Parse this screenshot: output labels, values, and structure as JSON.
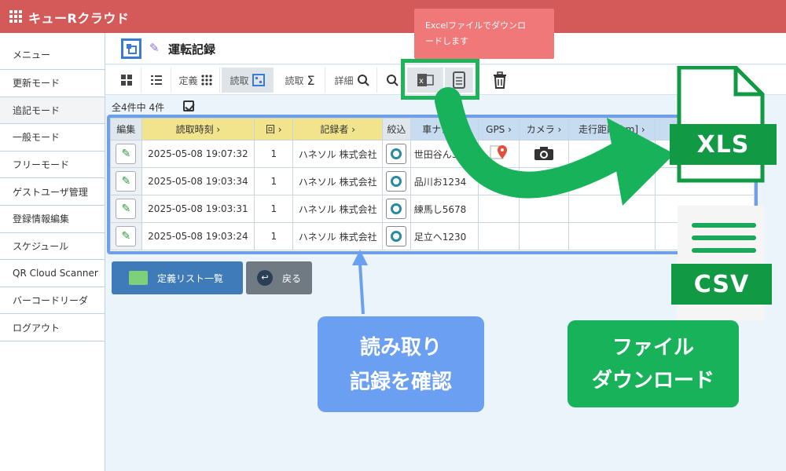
{
  "app": {
    "title": "キューRクラウド"
  },
  "sidebar": {
    "items": [
      {
        "label": "メニュー"
      },
      {
        "label": "更新モード"
      },
      {
        "label": "追記モード"
      },
      {
        "label": "一般モード"
      },
      {
        "label": "フリーモード"
      },
      {
        "label": "ゲストユーザ管理"
      },
      {
        "label": "登録情報編集"
      },
      {
        "label": "スケジュール"
      },
      {
        "label": "QR Cloud Scanner"
      },
      {
        "label": "バーコードリーダ"
      },
      {
        "label": "ログアウト"
      }
    ]
  },
  "page": {
    "title": "運転記録"
  },
  "toolbar": {
    "teigi": "定義",
    "yomitori1": "読取",
    "yomitori2": "読取",
    "shosai": "詳細"
  },
  "count": {
    "total": "全4件中",
    "shown": "4件"
  },
  "table": {
    "headers": {
      "edit": "編集",
      "time": "読取時刻",
      "kai": "回",
      "recorder": "記録者",
      "narrow": "絞込",
      "plate": "車ナンバ",
      "gps": "GPS",
      "camera": "カメラ",
      "distance": "走行距離[km]"
    },
    "rows": [
      {
        "time": "2025-05-08 19:07:32",
        "kai": "1",
        "recorder": "ハネソル 株式会社",
        "plate": "世田谷ん36"
      },
      {
        "time": "2025-05-08 19:03:34",
        "kai": "1",
        "recorder": "ハネソル 株式会社",
        "plate": "品川お1234"
      },
      {
        "time": "2025-05-08 19:03:31",
        "kai": "1",
        "recorder": "ハネソル 株式会社",
        "plate": "練馬し5678"
      },
      {
        "time": "2025-05-08 19:03:24",
        "kai": "1",
        "recorder": "ハネソル 株式会社",
        "plate": "足立へ1230"
      }
    ],
    "distance_partial": "1"
  },
  "buttons": {
    "list": "定義リスト一覧",
    "back": "戻る"
  },
  "tooltip": {
    "line1": "Excelファイルでダウンロ",
    "line2": "ードします"
  },
  "callouts": {
    "blue_line1": "読み取り",
    "blue_line2": "記録を確認",
    "green_line1": "ファイル",
    "green_line2": "ダウンロード"
  },
  "files": {
    "xls": "XLS",
    "csv": "CSV"
  },
  "colors": {
    "header": "#d35a58",
    "accent_green": "#1fb45a",
    "table_border": "#6f9fe6"
  }
}
